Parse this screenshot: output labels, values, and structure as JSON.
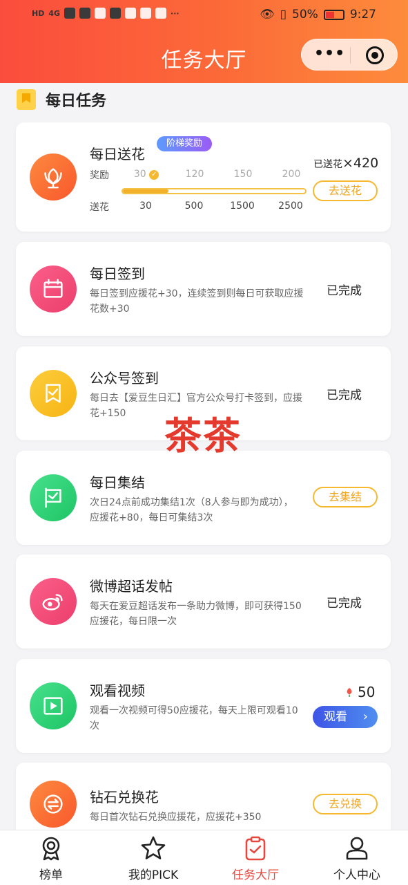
{
  "status_bar": {
    "battery": "50%",
    "time": "9:27",
    "network": "4G"
  },
  "header": {
    "title": "任务大厅",
    "more_icon": "more-dots-icon",
    "close_icon": "target-icon"
  },
  "section": {
    "title": "每日任务"
  },
  "tasks": [
    {
      "title": "每日送花",
      "badge": "阶梯奖励",
      "icon": "flower-icon",
      "color": "#fb6a34",
      "reward_label": "奖励",
      "send_label": "送花",
      "reward_ticks": [
        "30",
        "120",
        "150",
        "200"
      ],
      "send_ticks": [
        "30",
        "500",
        "1500",
        "2500"
      ],
      "progress": 0.25,
      "sent_label": "已送花",
      "sent_x": "×",
      "sent_count": "420",
      "button": "去送花"
    },
    {
      "title": "每日签到",
      "icon": "calendar-icon",
      "color": "#f0447a",
      "desc": "每日签到应援花+30，连续签到则每日可获取应援花数+30",
      "status": "已完成"
    },
    {
      "title": "公众号签到",
      "icon": "bookmark-check-icon",
      "color": "#fbbd24",
      "desc": "每日去【爱豆生日汇】官方公众号打卡签到，应援花+150",
      "status": "已完成"
    },
    {
      "title": "每日集结",
      "icon": "flag-icon",
      "color": "#2fd67a",
      "desc": "次日24点前成功集结1次（8人参与即为成功），应援花+80，每日可集结3次",
      "button": "去集结"
    },
    {
      "title": "微博超话发帖",
      "icon": "weibo-icon",
      "color": "#f0447a",
      "desc": "每天在爱豆超话发布一条助力微博，即可获得150应援花，每日限一次",
      "status": "已完成"
    },
    {
      "title": "观看视频",
      "icon": "play-icon",
      "color": "#2fd67a",
      "desc": "观看一次视频可得50应援花，每天上限可观看10次",
      "reward": "50",
      "button": "观看"
    },
    {
      "title": "钻石兑换花",
      "icon": "exchange-icon",
      "color": "#fb6a34",
      "desc": "每日首次钻石兑换应援花，应援花+350",
      "button": "去兑换"
    }
  ],
  "watermark": "茶茶",
  "tabs": [
    {
      "label": "榜单",
      "icon": "medal-icon"
    },
    {
      "label": "我的PICK",
      "icon": "star-icon"
    },
    {
      "label": "任务大厅",
      "icon": "clipboard-check-icon",
      "active": true
    },
    {
      "label": "个人中心",
      "icon": "user-icon"
    }
  ]
}
